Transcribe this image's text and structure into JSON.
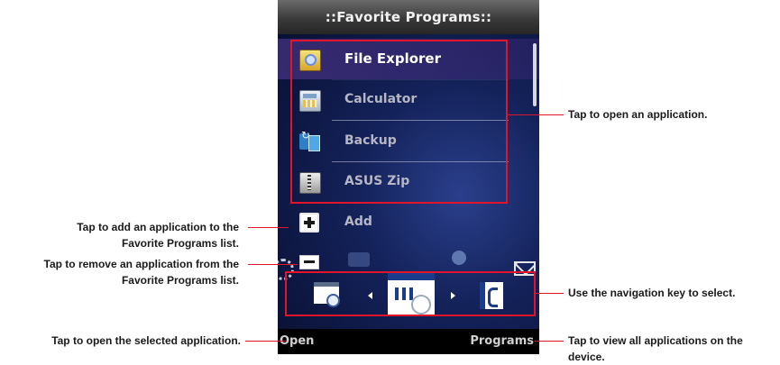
{
  "screen": {
    "title": "::Favorite Programs::",
    "items": [
      {
        "label": "File Explorer",
        "icon": "file-explorer-icon",
        "selected": true
      },
      {
        "label": "Calculator",
        "icon": "calculator-icon",
        "selected": false
      },
      {
        "label": "Backup",
        "icon": "backup-icon",
        "selected": false
      },
      {
        "label": "ASUS Zip",
        "icon": "asus-zip-icon",
        "selected": false
      },
      {
        "label": "Add",
        "icon": "add-icon",
        "selected": false
      }
    ],
    "softkeys": {
      "left": "Open",
      "right": "Programs"
    }
  },
  "callouts": {
    "open_app": "Tap to open an application.",
    "add_app": [
      "Tap to add an application to the",
      "Favorite Programs list."
    ],
    "remove_app": [
      "Tap to remove an application from the",
      "Favorite Programs list."
    ],
    "navigate": "Use the navigation key to select.",
    "open_selected": "Tap to open the selected application.",
    "view_all": [
      "Tap to view all applications on the",
      "device."
    ]
  },
  "colors": {
    "callout_line": "#e0152b"
  }
}
